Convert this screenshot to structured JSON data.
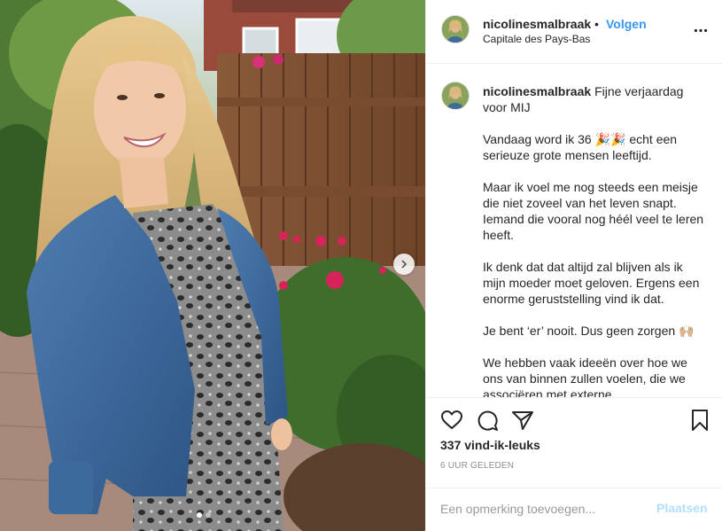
{
  "post": {
    "username": "nicolinesmalbraak",
    "separator": "•",
    "follow_label": "Volgen",
    "location": "Capitale des Pays-Bas",
    "more_icon": "more-horizontal-icon"
  },
  "caption": {
    "username": "nicolinesmalbraak",
    "first_line": "Fijne verjaardag voor MIJ",
    "paragraphs": [
      "Vandaag word ik 36 🎉🎉 echt een serieuze grote mensen leeftijd.",
      "Maar ik voel me nog steeds een meisje die niet zoveel van het leven snapt. Iemand die vooral nog héél veel te leren heeft.",
      "Ik denk dat dat altijd zal blijven als ik mijn moeder moet geloven. Ergens een enorme geruststelling vind ik dat.",
      "Je bent ‘er’ nooit. Dus geen zorgen 🙌🏼",
      "We hebben vaak ideeën over hoe we ons van binnen zullen voelen, die we associëren met externe"
    ]
  },
  "actions": {
    "like_icon": "heart-icon",
    "comment_icon": "comment-icon",
    "share_icon": "share-icon",
    "save_icon": "bookmark-icon",
    "likes_text": "337 vind-ik-leuks",
    "timestamp": "6 UUR GELEDEN"
  },
  "comment_box": {
    "placeholder": "Een opmerking toevoegen...",
    "post_label": "Plaatsen"
  },
  "carousel": {
    "total": 2,
    "active_index": 0
  },
  "colors": {
    "link_blue": "#3897f0",
    "post_disabled": "#b2dffc",
    "border": "#efefef",
    "muted": "#8e8e8e"
  }
}
